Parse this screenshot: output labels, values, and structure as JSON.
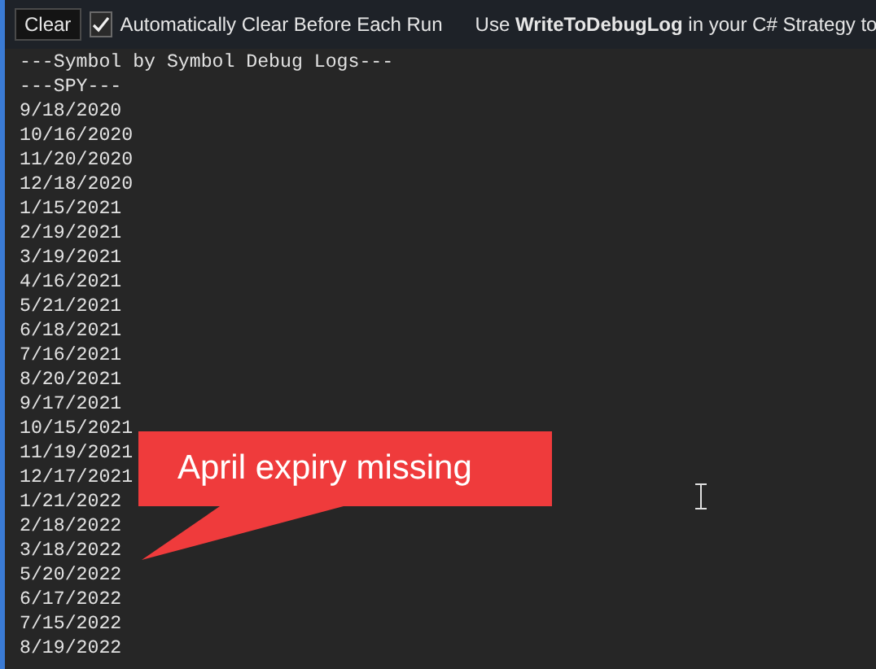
{
  "toolbar": {
    "clear_button": "Clear",
    "auto_clear": {
      "label": "Automatically Clear Before Each Run",
      "checked": true
    },
    "hint": "Use **WriteToDebugLog** in your C# Strategy to"
  },
  "log": {
    "lines": [
      "---Symbol by Symbol Debug Logs---",
      "---SPY---",
      "9/18/2020",
      "10/16/2020",
      "11/20/2020",
      "12/18/2020",
      "1/15/2021",
      "2/19/2021",
      "3/19/2021",
      "4/16/2021",
      "5/21/2021",
      "6/18/2021",
      "7/16/2021",
      "8/20/2021",
      "9/17/2021",
      "10/15/2021",
      "11/19/2021",
      "12/17/2021",
      "1/21/2022",
      "2/18/2022",
      "3/18/2022",
      "5/20/2022",
      "6/17/2022",
      "7/15/2022",
      "8/19/2022"
    ]
  },
  "callout": {
    "text": "April expiry missing"
  }
}
